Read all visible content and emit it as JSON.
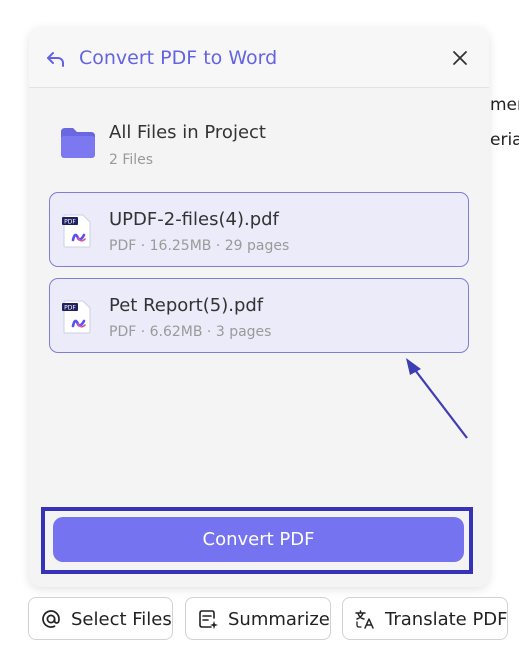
{
  "background": {
    "line1": "mer",
    "line2": "eria"
  },
  "panel": {
    "title": "Convert PDF to Word",
    "folder": {
      "name": "All Files in Project",
      "count": "2 Files"
    },
    "files": [
      {
        "name": "UPDF-2-files(4).pdf",
        "meta": "PDF · 16.25MB · 29 pages",
        "badge": "PDF"
      },
      {
        "name": "Pet Report(5).pdf",
        "meta": "PDF · 6.62MB · 3 pages",
        "badge": "PDF"
      }
    ],
    "convert_label": "Convert PDF"
  },
  "actions": {
    "select_files": "Select Files",
    "summarize": "Summarize",
    "translate": "Translate PDF"
  },
  "colors": {
    "accent": "#6463e6",
    "button": "#7573f0",
    "highlight": "#3633b8",
    "card_bg": "#ebebf9"
  },
  "icons": [
    "back-arrow-icon",
    "close-icon",
    "folder-icon",
    "pdf-file-icon",
    "at-sign-icon",
    "summarize-icon",
    "translate-icon"
  ]
}
